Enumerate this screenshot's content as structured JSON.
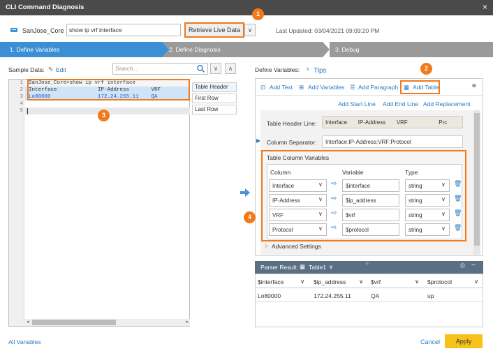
{
  "window": {
    "title": "CLI Command Diagnosis",
    "close": "×"
  },
  "top": {
    "device": "SanJose_Core",
    "command_value": "show ip vrf interface",
    "retrieve_label": "Retrieve Live Data",
    "dropdown": "∨",
    "last_updated": "Last Updated: 03/04/2021 09:09:20 PM"
  },
  "steps": [
    "1. Define Variables",
    "2. Define Diagnosis",
    "3. Debug"
  ],
  "callouts": [
    "1",
    "2",
    "3",
    "4"
  ],
  "left": {
    "sample_label": "Sample Data:",
    "edit": "Edit",
    "search_placeholder": "Search...",
    "lines": [
      {
        "n": "1",
        "text": "SanJose_Core>show ip vrf interface"
      },
      {
        "n": "2",
        "text": "Interface             IP-Address       VRF"
      },
      {
        "n": "3",
        "text": "Lo80000               172.24.255.11    QA"
      },
      {
        "n": "4",
        "text": ""
      },
      {
        "n": "5",
        "text": ""
      }
    ],
    "row_buttons": [
      "Table Header",
      "First Row",
      "Last Row"
    ]
  },
  "right": {
    "define_label": "Define Variables:",
    "tips": "Tips",
    "toolbar": [
      "Add Text",
      "Add Variables",
      "Add Paragraph",
      "Add Table"
    ],
    "sublinks": [
      "Add Start Line",
      "Add End Line",
      "Add Replacement"
    ],
    "header_line_label": "Table Header Line:",
    "header_line_value": "Interface       IP-Address       VRF                    Prc",
    "separator_label": "Column Separator:",
    "separator_value": "Interface;IP-Address;VRF;Protocol",
    "tcv_title": "Table Column Variables",
    "tcv_headers": [
      "Column",
      "Variable",
      "Type"
    ],
    "tcv_rows": [
      {
        "column": "Interface",
        "variable": "$interface",
        "type": "string"
      },
      {
        "column": "IP-Address",
        "variable": "$ip_address",
        "type": "string"
      },
      {
        "column": "VRF",
        "variable": "$vrf",
        "type": "string"
      },
      {
        "column": "Protocol",
        "variable": "$protocol",
        "type": "string"
      }
    ],
    "advanced": "Advanced Settings"
  },
  "parser": {
    "label": "Parser Result:",
    "table": "Table1",
    "headers": [
      "$interface",
      "$ip_address",
      "$vrf",
      "$protocol"
    ],
    "row": [
      "Lo80000",
      "172.24.255.11",
      "QA",
      "up"
    ]
  },
  "footer": {
    "all_vars": "All Variables",
    "cancel": "Cancel",
    "apply": "Apply"
  },
  "colors": {
    "accent": "#3b8fd4",
    "highlight": "#f07a1c",
    "apply": "#f7c31b"
  }
}
